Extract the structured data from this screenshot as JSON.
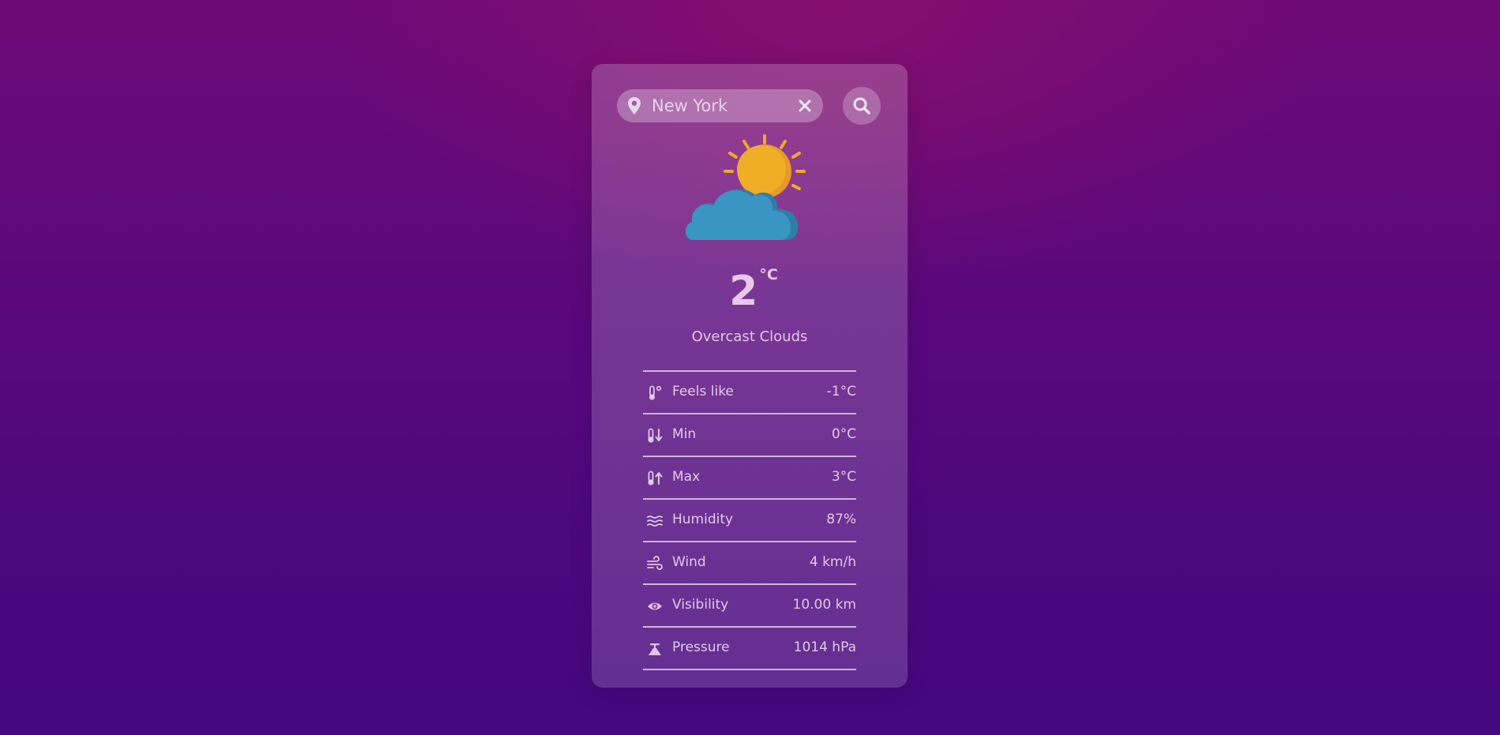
{
  "search": {
    "city_value": "New York",
    "pin_icon": "map-pin-icon",
    "clear_icon": "close-icon",
    "search_icon": "search-icon"
  },
  "weather": {
    "icon": "partly-cloudy-icon",
    "temperature": "2",
    "unit": "°C",
    "description": "Overcast Clouds"
  },
  "details": [
    {
      "icon": "thermometer-feels-icon",
      "label": "Feels like",
      "value": "-1°C"
    },
    {
      "icon": "thermometer-min-icon",
      "label": "Min",
      "value": "0°C"
    },
    {
      "icon": "thermometer-max-icon",
      "label": "Max",
      "value": "3°C"
    },
    {
      "icon": "humidity-icon",
      "label": "Humidity",
      "value": "87%"
    },
    {
      "icon": "wind-icon",
      "label": "Wind",
      "value": "4 km/h"
    },
    {
      "icon": "eye-icon",
      "label": "Visibility",
      "value": "10.00 km"
    },
    {
      "icon": "pressure-icon",
      "label": "Pressure",
      "value": "1014 hPa"
    }
  ],
  "colors": {
    "background_top": "#6e0a78",
    "background_bottom": "#43077e",
    "sun": "#f0a92a",
    "cloud": "#3a95c2",
    "text": "#ecd6ee"
  }
}
